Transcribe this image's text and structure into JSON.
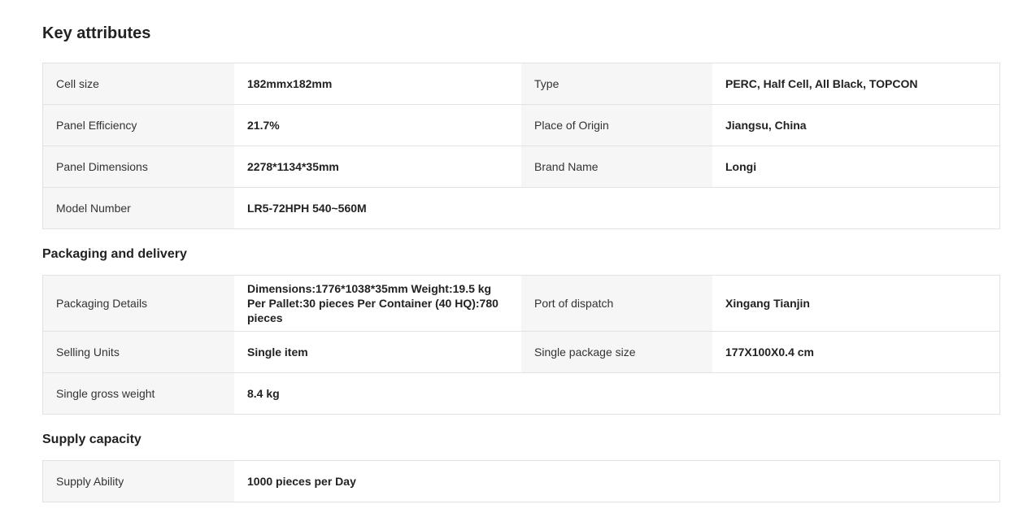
{
  "key_attributes": {
    "title": "Key attributes",
    "rows": [
      {
        "k1": "Cell size",
        "v1": "182mmx182mm",
        "k2": "Type",
        "v2": "PERC, Half Cell, All Black, TOPCON"
      },
      {
        "k1": "Panel Efficiency",
        "v1": "21.7%",
        "k2": "Place of Origin",
        "v2": "Jiangsu, China"
      },
      {
        "k1": "Panel Dimensions",
        "v1": "2278*1134*35mm",
        "k2": "Brand Name",
        "v2": "Longi"
      },
      {
        "k1": "Model Number",
        "v1": "LR5-72HPH 540~560M"
      }
    ]
  },
  "packaging": {
    "title": "Packaging and delivery",
    "rows": [
      {
        "k1": "Packaging Details",
        "v1": "Dimensions:1776*1038*35mm Weight:19.5 kg Per Pallet:30 pieces Per Container (40 HQ):780 pieces",
        "k2": "Port of dispatch",
        "v2": "Xingang Tianjin"
      },
      {
        "k1": "Selling Units",
        "v1": "Single item",
        "k2": "Single package size",
        "v2": "177X100X0.4 cm"
      },
      {
        "k1": "Single gross weight",
        "v1": "8.4 kg"
      }
    ]
  },
  "supply": {
    "title": "Supply capacity",
    "rows": [
      {
        "k1": "Supply Ability",
        "v1": "1000 pieces per Day"
      }
    ]
  }
}
